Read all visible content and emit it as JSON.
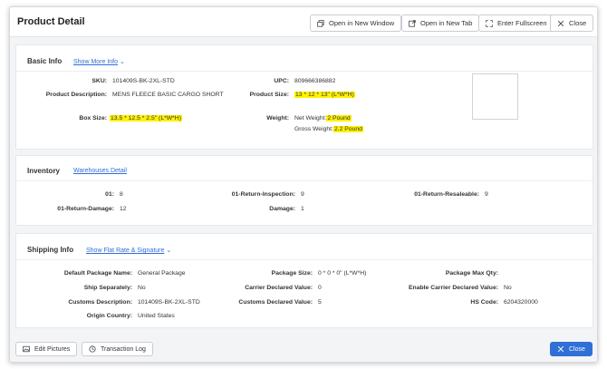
{
  "header": {
    "title": "Product Detail",
    "buttons": {
      "open_window": "Open in New Window",
      "open_tab": "Open in New Tab",
      "fullscreen": "Enter Fullscreen",
      "close": "Close"
    }
  },
  "basic_info": {
    "title": "Basic Info",
    "link": "Show More Info",
    "fields": {
      "sku": {
        "label": "SKU:",
        "value": "101409S-BK-2XL-STD"
      },
      "upc": {
        "label": "UPC:",
        "value": "809666386882"
      },
      "description": {
        "label": "Product Description:",
        "value": "MENS FLEECE BASIC CARGO SHORT"
      },
      "product_size": {
        "label": "Product Size:",
        "value": "13 * 12 * 13\" (L*W*H)"
      },
      "box_size": {
        "label": "Box Size:",
        "value": "13.5 * 12.5 * 2.5\" (L*W*H)"
      },
      "weight": {
        "label": "Weight:",
        "net_label": "Net Weight:",
        "net_value": "2 Pound",
        "gross_label": "Gross Weight:",
        "gross_value": "2.2 Pound"
      }
    }
  },
  "inventory": {
    "title": "Inventory",
    "link": "Warehouses Detail",
    "fields": {
      "w01": {
        "label": "01:",
        "value": "8"
      },
      "return_inspection": {
        "label": "01-Return-Inspection:",
        "value": "9"
      },
      "return_resaleable": {
        "label": "01-Return-Resaleable:",
        "value": "9"
      },
      "return_damage": {
        "label": "01-Return-Damage:",
        "value": "12"
      },
      "damage": {
        "label": "Damage:",
        "value": "1"
      }
    }
  },
  "shipping_info": {
    "title": "Shipping Info",
    "link": "Show Flat Rate & Signature",
    "fields": {
      "default_package": {
        "label": "Default Package Name:",
        "value": "General Package"
      },
      "package_size": {
        "label": "Package Size:",
        "value": "0 * 0 * 0\" (L*W*H)"
      },
      "package_max_qty": {
        "label": "Package Max Qty:",
        "value": ""
      },
      "ship_separately": {
        "label": "Ship Separately:",
        "value": "No"
      },
      "carrier_declared": {
        "label": "Carrier Declared Value:",
        "value": "0"
      },
      "enable_carrier_declared": {
        "label": "Enable Carrier Declared Value:",
        "value": "No"
      },
      "customs_description": {
        "label": "Customs Description:",
        "value": "101409S-BK-2XL-STD"
      },
      "customs_declared": {
        "label": "Customs Declared Value:",
        "value": "5"
      },
      "hs_code": {
        "label": "HS Code:",
        "value": "6204320000"
      },
      "origin_country": {
        "label": "Origin Country:",
        "value": "United States"
      }
    }
  },
  "footer": {
    "edit_pictures": "Edit Pictures",
    "transaction_log": "Transaction Log",
    "close": "Close"
  },
  "colors": {
    "accent": "#2f6fd6",
    "highlight": "#fff200"
  }
}
